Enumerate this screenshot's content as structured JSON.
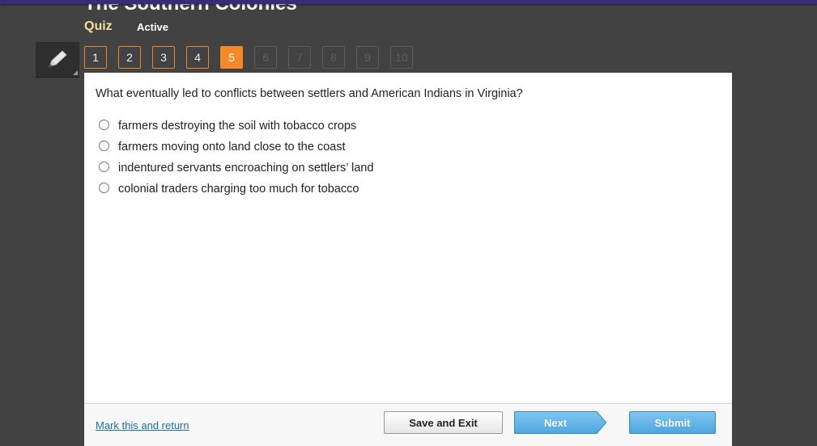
{
  "header": {
    "title": "The Southern Colonies",
    "activity_type": "Quiz",
    "status": "Active"
  },
  "toolbar": {
    "pencil_icon": "pencil-icon"
  },
  "question_nav": [
    {
      "label": "1",
      "state": "answered"
    },
    {
      "label": "2",
      "state": "answered"
    },
    {
      "label": "3",
      "state": "answered"
    },
    {
      "label": "4",
      "state": "answered"
    },
    {
      "label": "5",
      "state": "current"
    },
    {
      "label": "6",
      "state": "locked"
    },
    {
      "label": "7",
      "state": "locked"
    },
    {
      "label": "8",
      "state": "locked"
    },
    {
      "label": "9",
      "state": "locked"
    },
    {
      "label": "10",
      "state": "locked"
    }
  ],
  "question": {
    "text": "What eventually led to conflicts between settlers and American Indians in Virginia?",
    "options": [
      "farmers destroying the soil with tobacco crops",
      "farmers moving onto land close to the coast",
      "indentured servants encroaching on settlers’ land",
      "colonial traders charging too much for tobacco"
    ]
  },
  "footer": {
    "mark_link": "Mark this and return",
    "save_label": "Save and Exit",
    "next_label": "Next",
    "submit_label": "Submit"
  },
  "colors": {
    "accent_orange": "#f5892a",
    "top_bar": "#3a2a7c",
    "button_blue": "#5aaee6",
    "quiz_label": "#f5dfa0"
  }
}
